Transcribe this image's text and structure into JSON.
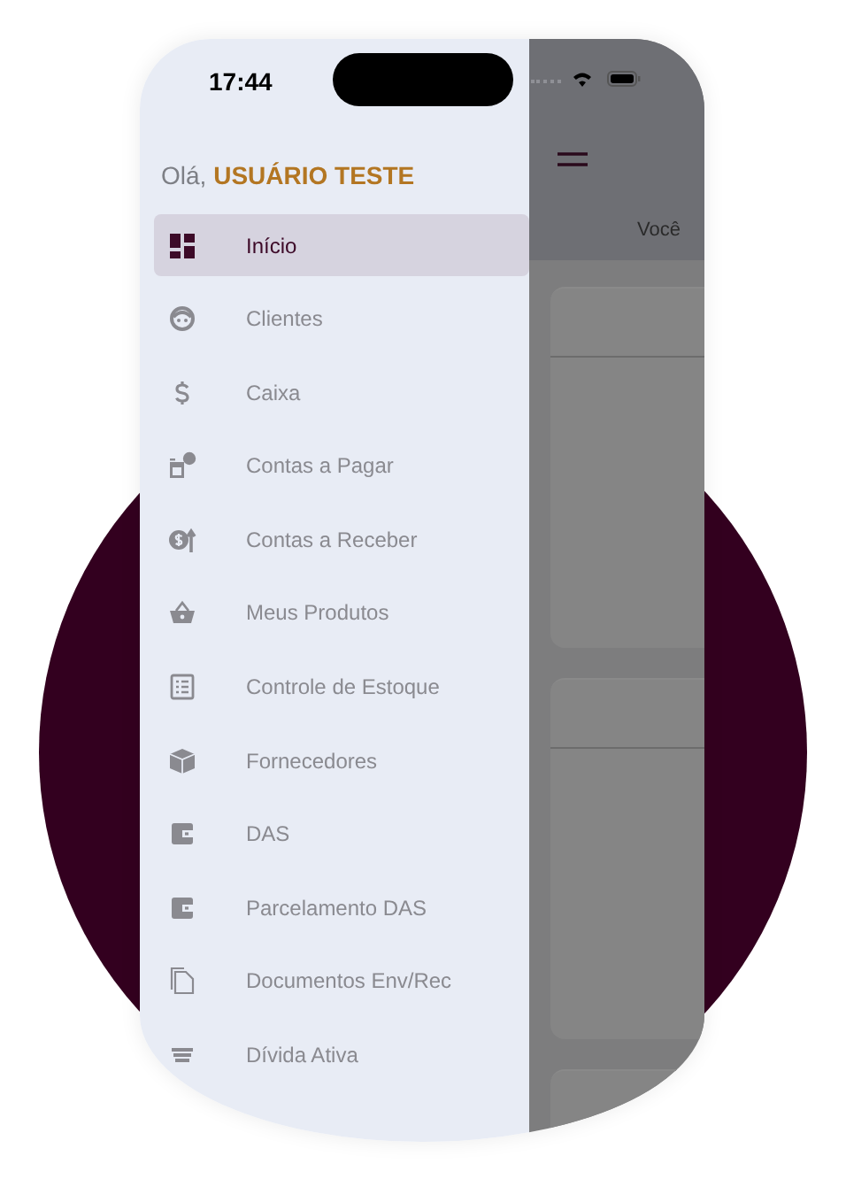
{
  "status_bar": {
    "time": "17:44"
  },
  "greeting": {
    "prefix": "Olá,",
    "user": "USUÁRIO TESTE"
  },
  "menu": [
    {
      "label": "Início",
      "selected": true
    },
    {
      "label": "Clientes",
      "selected": false
    },
    {
      "label": "Caixa",
      "selected": false
    },
    {
      "label": "Contas a Pagar",
      "selected": false
    },
    {
      "label": "Contas a Receber",
      "selected": false
    },
    {
      "label": "Meus Produtos",
      "selected": false
    },
    {
      "label": "Controle de Estoque",
      "selected": false
    },
    {
      "label": "Fornecedores",
      "selected": false
    },
    {
      "label": "DAS",
      "selected": false
    },
    {
      "label": "Parcelamento DAS",
      "selected": false
    },
    {
      "label": "Documentos Env/Rec",
      "selected": false
    },
    {
      "label": "Dívida Ativa",
      "selected": false
    }
  ],
  "background_screen": {
    "subtitle": "Você"
  }
}
